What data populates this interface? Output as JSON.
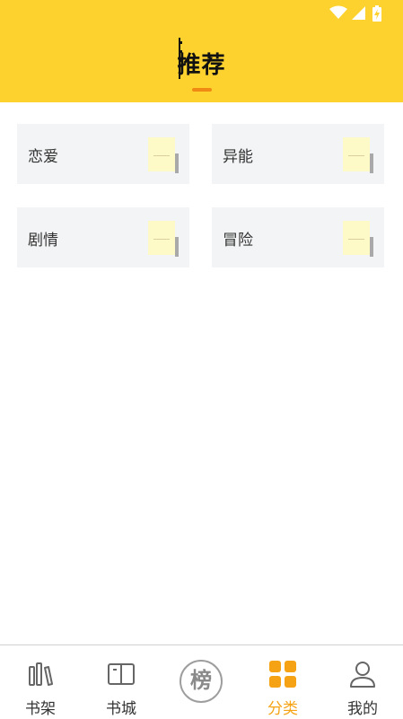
{
  "header": {
    "title": "推荐",
    "background_color": "#FDD22F",
    "indicator_color": "#F08A13"
  },
  "status_bar": {
    "icons": [
      "wifi-icon",
      "cell-signal-icon",
      "battery-charging-icon"
    ]
  },
  "categories": [
    {
      "label": "恋爱"
    },
    {
      "label": "异能"
    },
    {
      "label": "剧情"
    },
    {
      "label": "冒险"
    }
  ],
  "bottom_nav": {
    "active_color": "#F5A315",
    "items": [
      {
        "label": "书架",
        "icon": "bookshelf-icon",
        "active": false
      },
      {
        "label": "书城",
        "icon": "open-book-icon",
        "active": false
      },
      {
        "label": "",
        "icon": "ranking-icon",
        "glyph": "榜",
        "active": false
      },
      {
        "label": "分类",
        "icon": "category-grid-icon",
        "active": true
      },
      {
        "label": "我的",
        "icon": "user-icon",
        "active": false
      }
    ]
  }
}
